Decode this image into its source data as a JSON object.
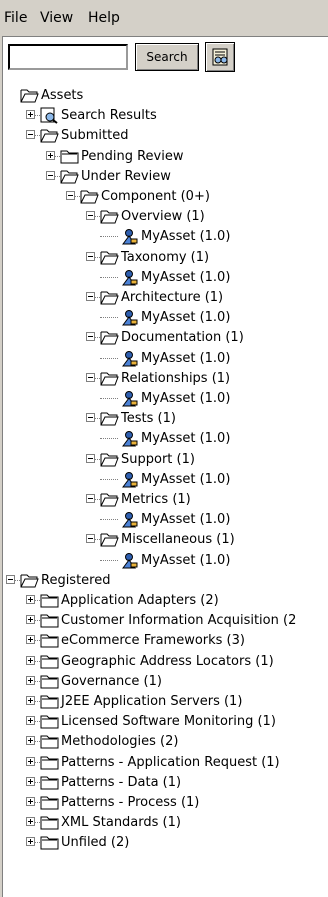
{
  "menu": [
    "File",
    "View",
    "Help"
  ],
  "search": {
    "value": "",
    "button_label": "Search"
  },
  "tree": [
    {
      "label": "Assets",
      "depth": 0,
      "type": "folder-open",
      "expander": "none"
    },
    {
      "label": "Search Results",
      "depth": 1,
      "type": "search",
      "expander": "plus"
    },
    {
      "label": "Submitted",
      "depth": 1,
      "type": "folder-open",
      "expander": "minus"
    },
    {
      "label": "Pending Review",
      "depth": 2,
      "type": "folder",
      "expander": "plus"
    },
    {
      "label": "Under Review",
      "depth": 2,
      "type": "folder-open",
      "expander": "minus"
    },
    {
      "label": "Component (0+)",
      "depth": 3,
      "type": "folder-open",
      "expander": "minus"
    },
    {
      "label": "Overview (1)",
      "depth": 4,
      "type": "folder-open",
      "expander": "minus"
    },
    {
      "label": "MyAsset (1.0)",
      "depth": 5,
      "type": "asset",
      "expander": "none"
    },
    {
      "label": "Taxonomy (1)",
      "depth": 4,
      "type": "folder-open",
      "expander": "minus"
    },
    {
      "label": "MyAsset (1.0)",
      "depth": 5,
      "type": "asset",
      "expander": "none"
    },
    {
      "label": "Architecture (1)",
      "depth": 4,
      "type": "folder-open",
      "expander": "minus"
    },
    {
      "label": "MyAsset (1.0)",
      "depth": 5,
      "type": "asset",
      "expander": "none"
    },
    {
      "label": "Documentation (1)",
      "depth": 4,
      "type": "folder-open",
      "expander": "minus"
    },
    {
      "label": "MyAsset (1.0)",
      "depth": 5,
      "type": "asset",
      "expander": "none"
    },
    {
      "label": "Relationships (1)",
      "depth": 4,
      "type": "folder-open",
      "expander": "minus"
    },
    {
      "label": "MyAsset (1.0)",
      "depth": 5,
      "type": "asset",
      "expander": "none"
    },
    {
      "label": "Tests (1)",
      "depth": 4,
      "type": "folder-open",
      "expander": "minus"
    },
    {
      "label": "MyAsset (1.0)",
      "depth": 5,
      "type": "asset",
      "expander": "none"
    },
    {
      "label": "Support (1)",
      "depth": 4,
      "type": "folder-open",
      "expander": "minus"
    },
    {
      "label": "MyAsset (1.0)",
      "depth": 5,
      "type": "asset",
      "expander": "none"
    },
    {
      "label": "Metrics (1)",
      "depth": 4,
      "type": "folder-open",
      "expander": "minus"
    },
    {
      "label": "MyAsset (1.0)",
      "depth": 5,
      "type": "asset",
      "expander": "none"
    },
    {
      "label": "Miscellaneous (1)",
      "depth": 4,
      "type": "folder-open",
      "expander": "minus"
    },
    {
      "label": "MyAsset (1.0)",
      "depth": 5,
      "type": "asset",
      "expander": "none"
    },
    {
      "label": "Registered",
      "depth": 0,
      "type": "folder-open",
      "expander": "minus"
    },
    {
      "label": "Application Adapters (2)",
      "depth": 1,
      "type": "folder",
      "expander": "plus"
    },
    {
      "label": "Customer Information Acquisition (2",
      "depth": 1,
      "type": "folder",
      "expander": "plus"
    },
    {
      "label": "eCommerce Frameworks (3)",
      "depth": 1,
      "type": "folder",
      "expander": "plus"
    },
    {
      "label": "Geographic Address Locators (1)",
      "depth": 1,
      "type": "folder",
      "expander": "plus"
    },
    {
      "label": "Governance (1)",
      "depth": 1,
      "type": "folder",
      "expander": "plus"
    },
    {
      "label": "J2EE Application Servers (1)",
      "depth": 1,
      "type": "folder",
      "expander": "plus"
    },
    {
      "label": "Licensed Software Monitoring (1)",
      "depth": 1,
      "type": "folder",
      "expander": "plus"
    },
    {
      "label": "Methodologies (2)",
      "depth": 1,
      "type": "folder",
      "expander": "plus"
    },
    {
      "label": "Patterns - Application Request (1)",
      "depth": 1,
      "type": "folder",
      "expander": "plus"
    },
    {
      "label": "Patterns - Data (1)",
      "depth": 1,
      "type": "folder",
      "expander": "plus"
    },
    {
      "label": "Patterns - Process (1)",
      "depth": 1,
      "type": "folder",
      "expander": "plus"
    },
    {
      "label": "XML Standards (1)",
      "depth": 1,
      "type": "folder",
      "expander": "plus"
    },
    {
      "label": "Unfiled (2)",
      "depth": 1,
      "type": "folder",
      "expander": "plus"
    }
  ]
}
